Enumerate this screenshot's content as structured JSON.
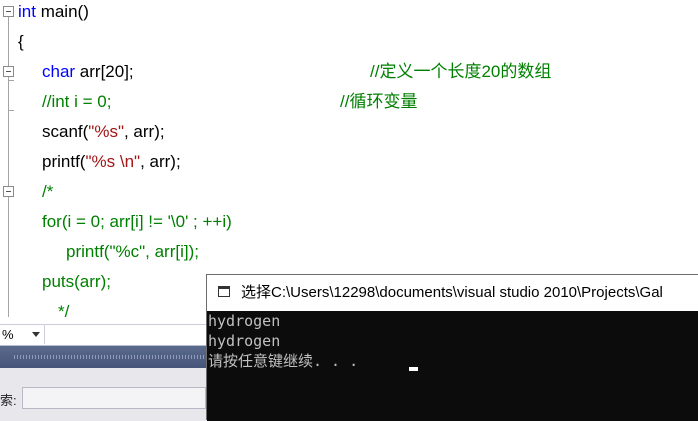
{
  "editor": {
    "lines": [
      {
        "kw": "int",
        "text": " main()"
      },
      {
        "text": "{"
      },
      {
        "kw": "char",
        "text": " arr[20];",
        "comment": "//定义一个长度20的数组"
      },
      {
        "comment_inline": "//int i = 0;",
        "comment": "//循环变量"
      },
      {
        "pre": "scanf(",
        "str": "\"%s\"",
        "post": ", arr);"
      },
      {
        "pre": "printf(",
        "str": "\"%s \\n\"",
        "post": ", arr);"
      },
      {
        "comment_inline": "/*"
      },
      {
        "comment_inline": "for(i = 0; arr[i] != '\\0' ; ++i)"
      },
      {
        "comment_inline": "printf(\"%c\", arr[i]);"
      },
      {
        "comment_inline": "puts(arr);"
      },
      {
        "comment_inline": "*/"
      }
    ]
  },
  "zoom": {
    "value": "%"
  },
  "bottom_panel": {
    "search_label": "索:",
    "search_value": ""
  },
  "console": {
    "title": "选择C:\\Users\\12298\\documents\\visual studio 2010\\Projects\\Gal",
    "lines": [
      "hydrogen",
      "hydrogen",
      "请按任意键继续. . . "
    ]
  },
  "colors": {
    "keyword": "#0000ff",
    "string": "#a31515",
    "comment": "#008000",
    "console_bg": "#0c0c0c",
    "console_text": "#c0c0c0"
  }
}
